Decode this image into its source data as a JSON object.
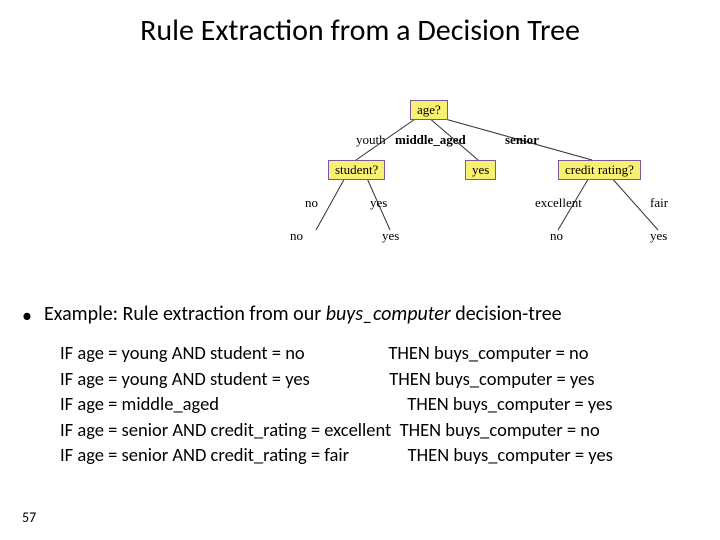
{
  "title": "Rule Extraction from a Decision Tree",
  "tree": {
    "root": "age?",
    "edge_youth": "youth",
    "edge_middle": "middle_aged",
    "edge_senior": "senior",
    "node_student": "student?",
    "node_mid_yes": "yes",
    "node_credit": "credit rating?",
    "edge_stu_no": "no",
    "edge_stu_yes": "yes",
    "edge_cr_exc": "excellent",
    "edge_cr_fair": "fair",
    "leaf_stu_no": "no",
    "leaf_stu_yes": "yes",
    "leaf_cr_exc": "no",
    "leaf_cr_fair": "yes"
  },
  "bullet": {
    "prefix": "Example: Rule extraction from our ",
    "italic": "buys_computer",
    "suffix": " decision-tree"
  },
  "rules": {
    "r1_if": "IF age = young AND student = no",
    "r1_then": "THEN buys_computer = no",
    "r2_if": "IF age = young AND student = yes",
    "r2_then": "THEN buys_computer = yes",
    "r3_if": "IF age = middle_aged",
    "r3_then": "THEN buys_computer = yes",
    "r4_if": "IF age = senior AND credit_rating = excellent",
    "r4_then": "THEN buys_computer = no",
    "r5_if": "IF age = senior AND credit_rating = fair",
    "r5_then": "THEN buys_computer = yes"
  },
  "page_number": "57"
}
